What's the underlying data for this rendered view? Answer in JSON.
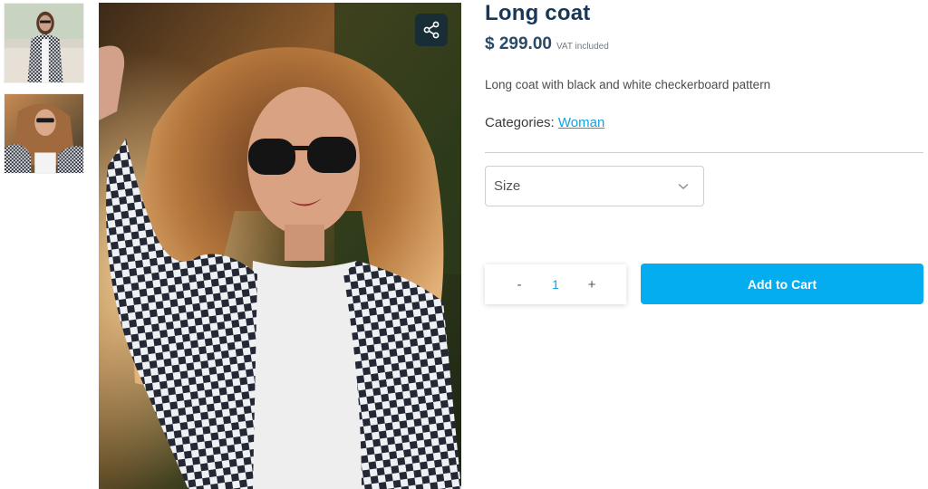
{
  "product": {
    "title": "Long coat",
    "price": "$ 299.00",
    "vat_note": "VAT included",
    "description": "Long coat with black and white checkerboard pattern",
    "categories_label": "Categories:",
    "category_link": "Woman"
  },
  "gallery": {
    "thumbnails": [
      {
        "icon": "product-thumbnail-1"
      },
      {
        "icon": "product-thumbnail-2"
      }
    ],
    "main_image": "product-main-photo",
    "share_icon": "share-icon"
  },
  "options": {
    "size_placeholder": "Size",
    "size_icon": "chevron-down-icon"
  },
  "cart": {
    "minus_label": "-",
    "quantity": "1",
    "plus_label": "+",
    "add_label": "Add to Cart"
  },
  "colors": {
    "title": "#17385a",
    "accent": "#04adf0",
    "link": "#0fa3e6",
    "share_bg": "#152b3a"
  }
}
